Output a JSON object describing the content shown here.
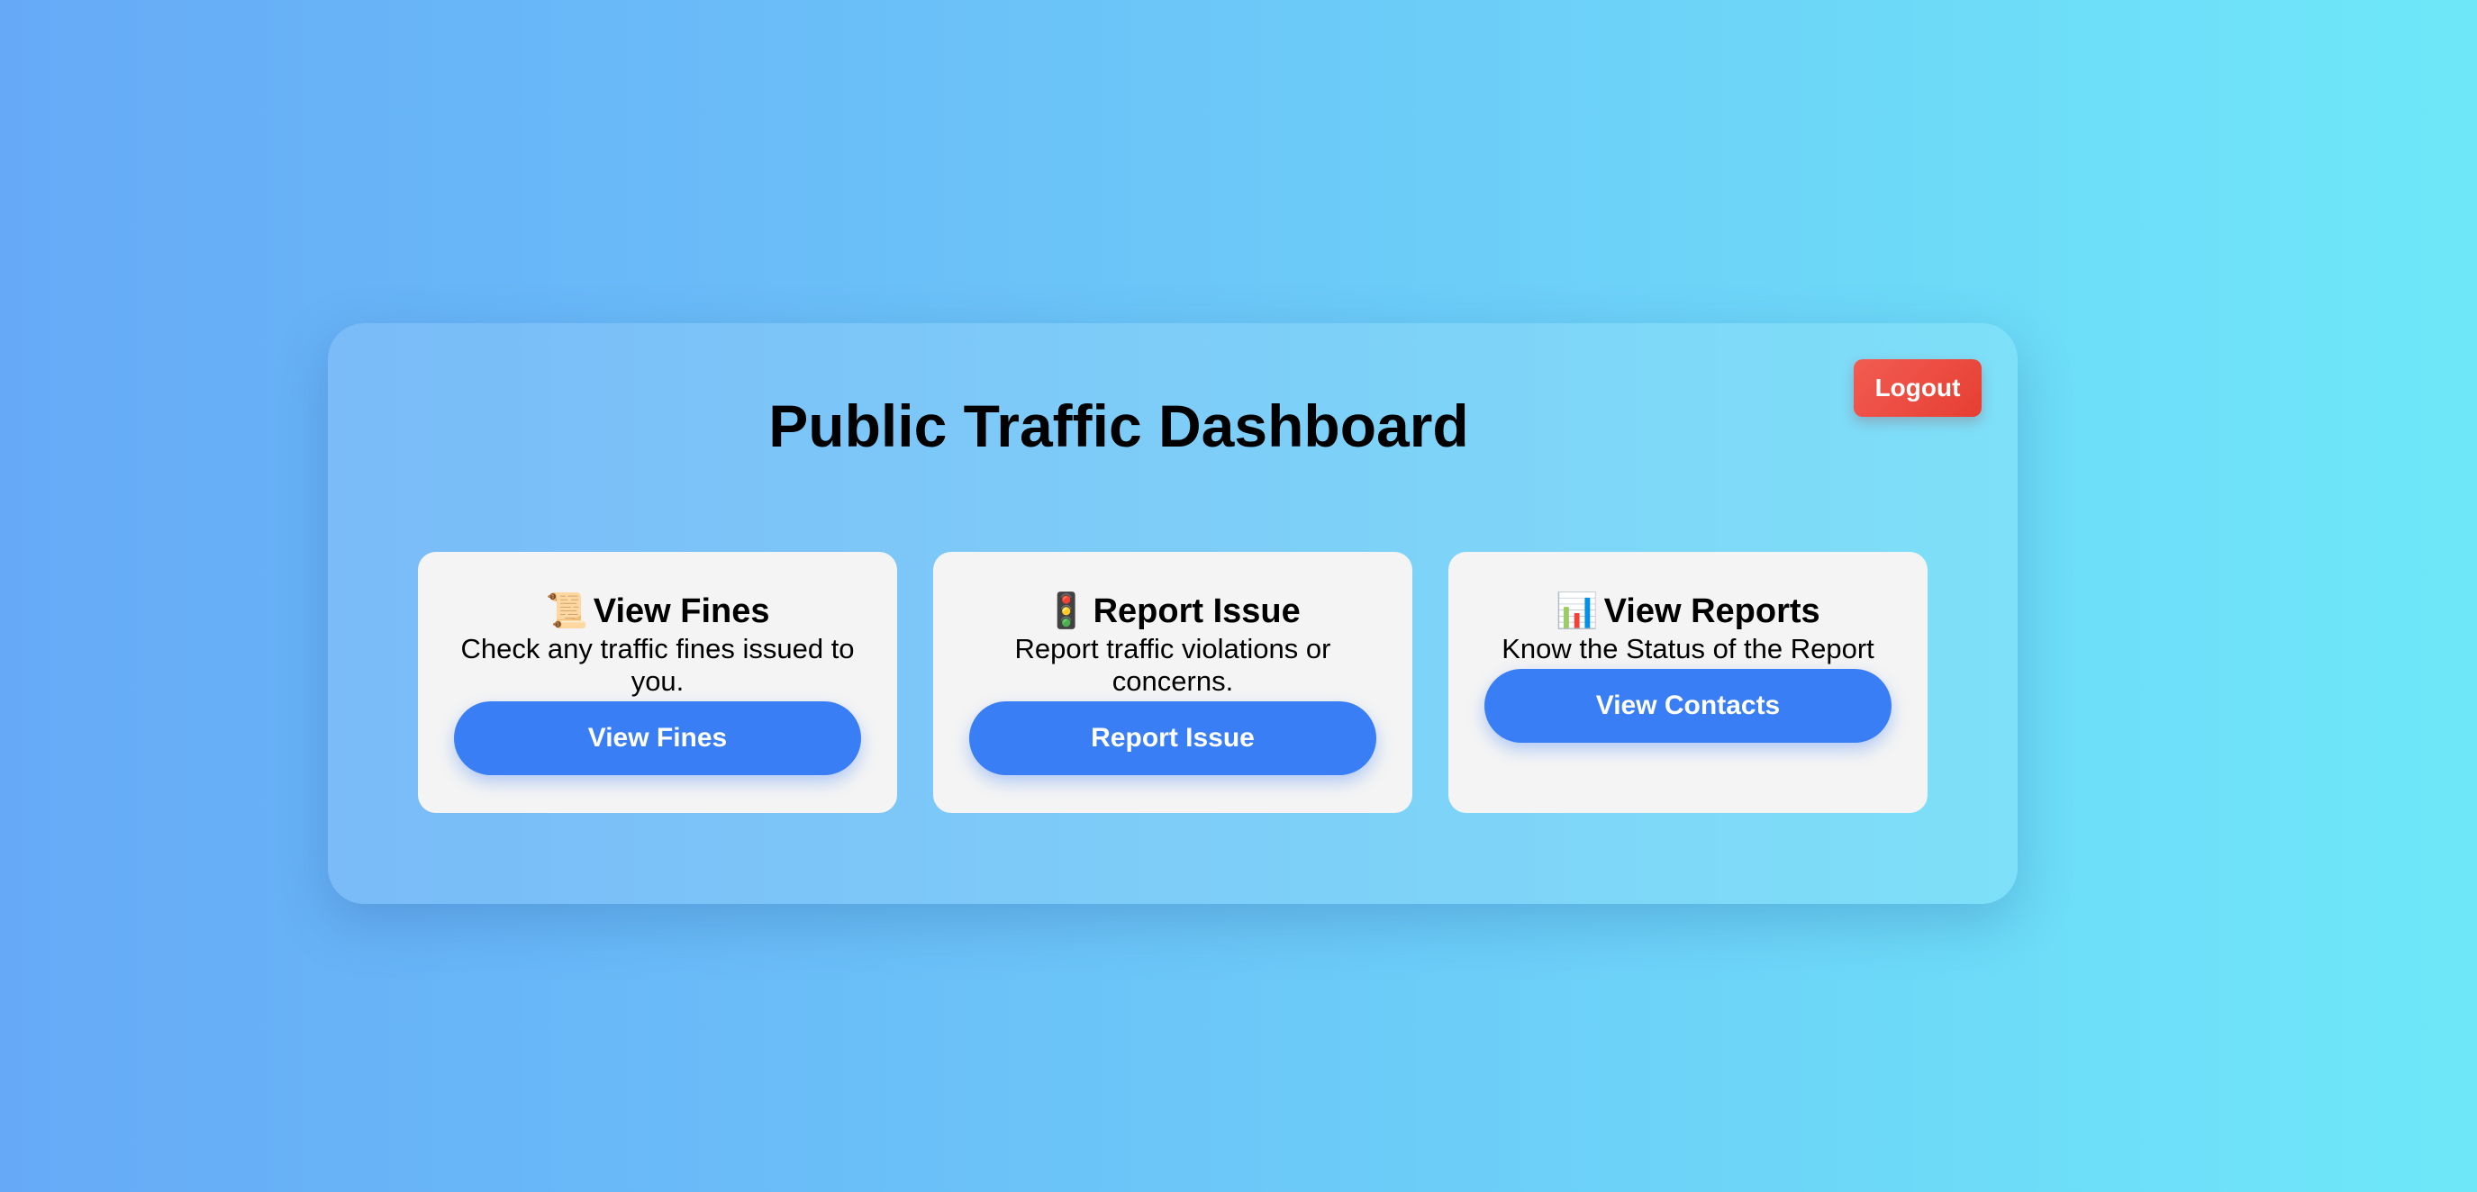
{
  "header": {
    "title": "Public Traffic Dashboard",
    "logout_label": "Logout"
  },
  "cards": [
    {
      "icon": "📜",
      "icon_name": "scroll-icon",
      "title": "View Fines",
      "description": "Check any traffic fines issued to you.",
      "button_label": "View Fines"
    },
    {
      "icon": "🚦",
      "icon_name": "traffic-light-icon",
      "title": "Report Issue",
      "description": "Report traffic violations or concerns.",
      "button_label": "Report Issue"
    },
    {
      "icon": "📊",
      "icon_name": "bar-chart-icon",
      "title": "View Reports",
      "description": "Know the Status of the Report",
      "button_label": "View Contacts"
    }
  ],
  "colors": {
    "primary_button": "#3a7ef5",
    "logout_button": "#e63e32",
    "card_background": "#f4f4f4"
  }
}
